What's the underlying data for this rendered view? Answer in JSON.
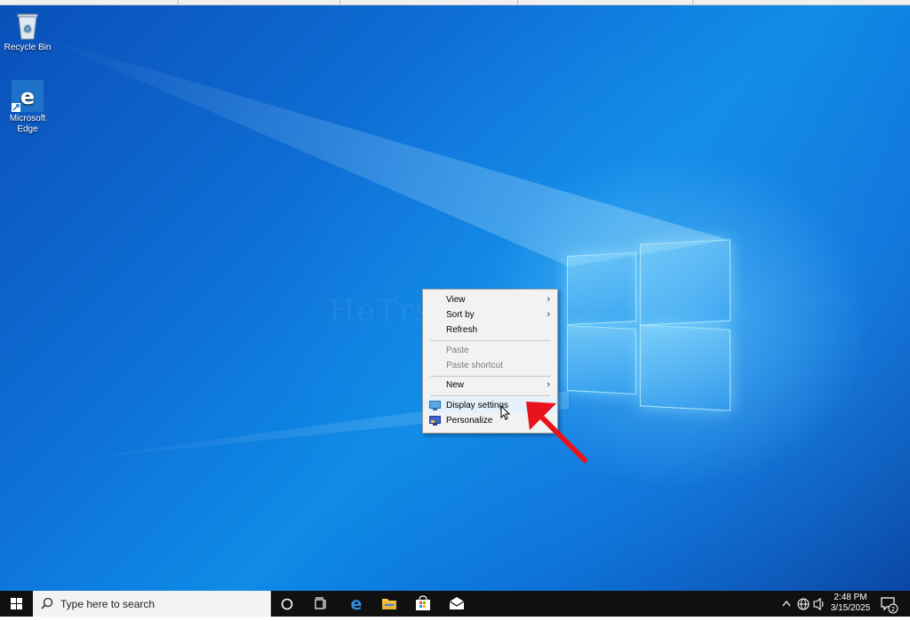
{
  "desktop": {
    "icons": [
      {
        "label": "Recycle Bin",
        "icon": "recycle-bin-icon"
      },
      {
        "label": "Microsoft Edge",
        "icon": "edge-icon"
      }
    ],
    "watermark": "HeTrs HL"
  },
  "context_menu": {
    "items": [
      {
        "label": "View",
        "submenu": true,
        "enabled": true
      },
      {
        "label": "Sort by",
        "submenu": true,
        "enabled": true
      },
      {
        "label": "Refresh",
        "submenu": false,
        "enabled": true
      },
      {
        "label": "Paste",
        "submenu": false,
        "enabled": false
      },
      {
        "label": "Paste shortcut",
        "submenu": false,
        "enabled": false
      },
      {
        "label": "New",
        "submenu": true,
        "enabled": true
      },
      {
        "label": "Display settings",
        "submenu": false,
        "enabled": true,
        "icon": "display-icon",
        "hovered": true
      },
      {
        "label": "Personalize",
        "submenu": false,
        "enabled": true,
        "icon": "personalize-icon"
      }
    ]
  },
  "taskbar": {
    "search_placeholder": "Type here to search",
    "pinned": [
      "cortana-icon",
      "task-view-icon",
      "edge-icon",
      "file-explorer-icon",
      "store-icon",
      "mail-icon"
    ],
    "clock": {
      "time": "2:48 PM",
      "date": "3/15/2025"
    },
    "notifications_count": "2"
  },
  "colors": {
    "accent_red": "#e8141b",
    "desktop_blue": "#0e72d8",
    "taskbar": "#101010"
  }
}
